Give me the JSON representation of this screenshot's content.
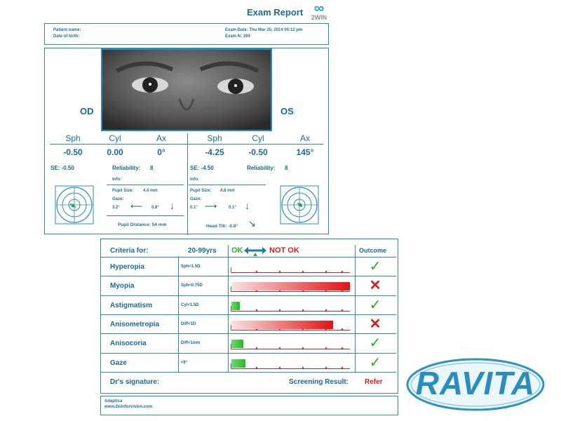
{
  "header": {
    "title": "Exam Report",
    "logo_text": "2WIN",
    "logo_symbol": "∞"
  },
  "patient": {
    "name_label": "Patient name:",
    "dob_label": "Date of birth:",
    "exam_date": "Exam Date: Thu Mar 20, 2014  05:12 pm",
    "exam_n": "Exam N: 394"
  },
  "eyes": {
    "od_label": "OD",
    "os_label": "OS",
    "headers": [
      "Sph",
      "Cyl",
      "Ax",
      "Sph",
      "Cyl",
      "Ax"
    ],
    "od": {
      "sph": "-0.50",
      "cyl": "0.00",
      "ax": "0°",
      "se": "SE: -0.50",
      "reliability_label": "Reliability:",
      "reliability": "8",
      "info": "Info:",
      "pupil_label": "Pupil Size:",
      "pupil": "4.4 mm",
      "gaze_label": "Gaze:",
      "gaze_h": "3.2°",
      "gaze_v": "0.8°",
      "arrow_h": "⟵",
      "arrow_v": "↓"
    },
    "os": {
      "sph": "-4.25",
      "cyl": "-0.50",
      "ax": "145°",
      "se": "SE: -4.50",
      "reliability_label": "Reliability:",
      "reliability": "8",
      "info": "Info:",
      "pupil_label": "Pupil Size:",
      "pupil": "4.8 mm",
      "gaze_label": "Gaze:",
      "gaze_h": "0.1°",
      "gaze_v": "0.1°",
      "arrow_h": "⟶",
      "arrow_v": "↓"
    },
    "pupil_distance": "Pupil Distance: 54 mm",
    "head_tilt": "Head Tilt: -0.8°",
    "head_tilt_arrow": "↘"
  },
  "criteria": {
    "title": "Criteria for:",
    "age": "20-99yrs",
    "ok_label": "OK",
    "notok_label": "NOT OK",
    "outcome_label": "Outcome",
    "rows": [
      {
        "name": "Hyperopia",
        "threshold": "Sph<1.5D",
        "level": 0.0,
        "outcome": "ok"
      },
      {
        "name": "Myopia",
        "threshold": "Sph<0.75D",
        "level": 1.0,
        "outcome": "refer"
      },
      {
        "name": "Astigmatism",
        "threshold": "Cyl<1.5D",
        "level": 0.07,
        "outcome": "ok"
      },
      {
        "name": "Anisometropia",
        "threshold": "Diff<1D",
        "level": 0.86,
        "outcome": "refer"
      },
      {
        "name": "Anisocoria",
        "threshold": "Diff<1mm",
        "level": 0.1,
        "outcome": "ok"
      },
      {
        "name": "Gaze",
        "threshold": "<6°",
        "level": 0.12,
        "outcome": "ok"
      }
    ],
    "ok_symbol": "✓",
    "refer_symbol": "✕",
    "signature_label": "Dr's signature:",
    "screening_label": "Screening Result:",
    "screening_value": "Refer"
  },
  "footer": {
    "company": "Adaptica",
    "website": "www.2winforvision.com"
  },
  "brand": {
    "logo_text": "RAVITA"
  },
  "colors": {
    "accent": "#2a8bb8",
    "ok": "#22b022",
    "refer": "#d81b1b"
  }
}
